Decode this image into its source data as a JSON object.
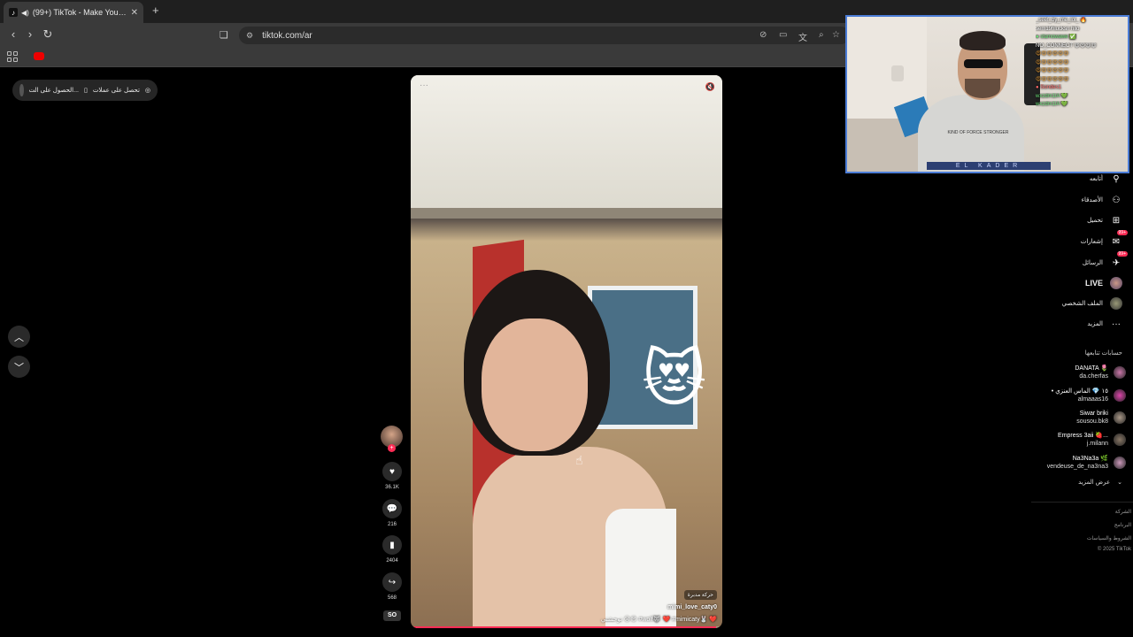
{
  "browser": {
    "tab_title": "(99+) TikTok - Make Your Day",
    "tab_close": "✕",
    "new_tab": "+",
    "url": "tiktok.com/ar"
  },
  "left_pill": {
    "item1": "تحصل على عملات",
    "item2": "الحصول على الت..."
  },
  "video": {
    "tag_label": "حركة مدبرة",
    "author": "mimi_love_caty0",
    "caption": "توحشتي 😢😍 #wolf🐺 ❤️ #mimicaty🐰 ❤️",
    "progress": 0.98
  },
  "actions": {
    "likes": "36.1K",
    "comments": "216",
    "saves": "2404",
    "shares": "568",
    "music_badge": "SO"
  },
  "webcam": {
    "chat": [
      {
        "text": "_seef_by_me_lol_ 🔥",
        "style": "w"
      },
      {
        "text": "sem19hlucksn hllo",
        "style": "w"
      },
      {
        "text": "● slamowawe ✅",
        "style": "green"
      },
      {
        "text": "NO_CONNECT 😍😍😍😍",
        "style": "w"
      },
      {
        "text": "😍😍😍😍😍😍",
        "style": "em"
      },
      {
        "text": "😍😍😍😍😍😍",
        "style": "em"
      },
      {
        "text": "😍😍😍😍😍😍",
        "style": "em"
      },
      {
        "text": "😍😍😍😍😍😍",
        "style": "em"
      },
      {
        "text": "● Sondes1",
        "style": "red"
      },
      {
        "text": "wxzdm1lA 💚",
        "style": "green"
      },
      {
        "text": "wxzdm1lA 💚",
        "style": "green"
      }
    ],
    "shirt_text": "KIND OF FORCE STRONGER",
    "banner": "EL KADER"
  },
  "sidebar": {
    "items": [
      {
        "label": "أتابعه",
        "icon": "follow-icon",
        "glyph": "⚲"
      },
      {
        "label": "الأصدقاء",
        "icon": "friends-icon",
        "glyph": "⚇"
      },
      {
        "label": "تحميل",
        "icon": "upload-icon",
        "glyph": "⊞"
      },
      {
        "label": "إشعارات",
        "icon": "inbox-icon",
        "glyph": "✉",
        "badge": "99+"
      },
      {
        "label": "الرسائل",
        "icon": "messages-icon",
        "glyph": "✈",
        "badge": "99+"
      },
      {
        "label": "LIVE",
        "icon": "live-icon",
        "glyph": ""
      },
      {
        "label": "الملف الشخصي",
        "icon": "profile-icon",
        "glyph": ""
      },
      {
        "label": "المزيد",
        "icon": "more-icon",
        "glyph": "···"
      }
    ],
    "following_heading": "حسابات تتابعها",
    "following": [
      {
        "name": "DANATA 🌷",
        "handle": "da.cherfas"
      },
      {
        "name": "• ١٥ 💎 الماس العنزي",
        "handle": "almaaas16"
      },
      {
        "name": "Siwar briki",
        "handle": "sousou.bk8"
      },
      {
        "name": "Empress 3aii 🍓...",
        "handle": "j.milann"
      },
      {
        "name": "Na3Na3a 🌿",
        "handle": "vendeuse_de_na3na3"
      }
    ],
    "see_more": "عرض المزيد",
    "footer": [
      "الشركة",
      "البرنامج",
      "الشروط والسياسات",
      "© 2025 TikTok"
    ]
  }
}
